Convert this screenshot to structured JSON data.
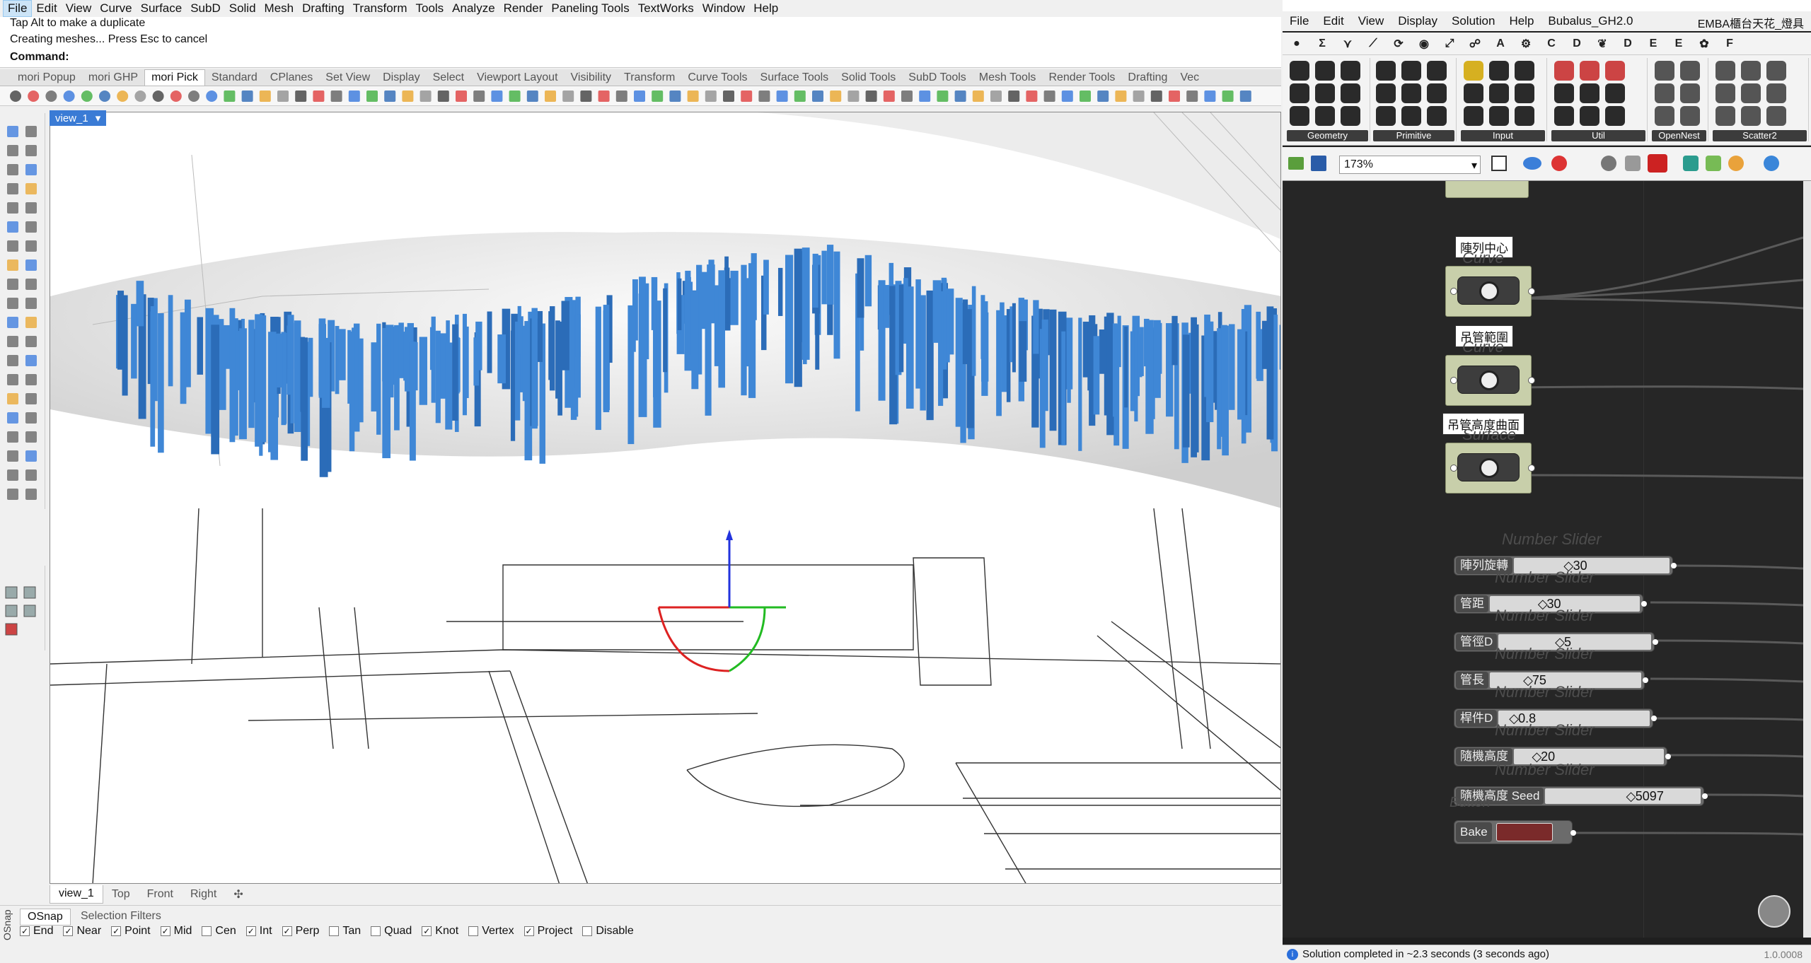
{
  "rhino": {
    "menu": [
      "File",
      "Edit",
      "View",
      "Curve",
      "Surface",
      "SubD",
      "Solid",
      "Mesh",
      "Drafting",
      "Transform",
      "Tools",
      "Analyze",
      "Render",
      "Paneling Tools",
      "TextWorks",
      "Window",
      "Help"
    ],
    "command_history": [
      "Tap Alt to make a duplicate",
      "Creating meshes... Press Esc to cancel"
    ],
    "command_prompt": "Command:",
    "toolbar_tabs": [
      "mori Popup",
      "mori GHP",
      "mori Pick",
      "Standard",
      "CPlanes",
      "Set View",
      "Display",
      "Select",
      "Viewport Layout",
      "Visibility",
      "Transform",
      "Curve Tools",
      "Surface Tools",
      "Solid Tools",
      "SubD Tools",
      "Mesh Tools",
      "Render Tools",
      "Drafting",
      "Vec"
    ],
    "active_tab": "mori Pick",
    "viewport_label": "view_1",
    "viewport_tabs": [
      "view_1",
      "Top",
      "Front",
      "Right"
    ],
    "osnap_tabs": [
      "OSnap",
      "Selection Filters"
    ],
    "osnap_side_label": "OSnap",
    "osnaps": [
      {
        "label": "End",
        "checked": true
      },
      {
        "label": "Near",
        "checked": true
      },
      {
        "label": "Point",
        "checked": true
      },
      {
        "label": "Mid",
        "checked": true
      },
      {
        "label": "Cen",
        "checked": false
      },
      {
        "label": "Int",
        "checked": true
      },
      {
        "label": "Perp",
        "checked": true
      },
      {
        "label": "Tan",
        "checked": false
      },
      {
        "label": "Quad",
        "checked": false
      },
      {
        "label": "Knot",
        "checked": true
      },
      {
        "label": "Vertex",
        "checked": false
      },
      {
        "label": "Project",
        "checked": true
      },
      {
        "label": "Disable",
        "checked": false
      }
    ]
  },
  "grasshopper": {
    "menu": [
      "File",
      "Edit",
      "View",
      "Display",
      "Solution",
      "Help",
      "Bubalus_GH2.0"
    ],
    "doc_title": "EMBA櫃台天花_燈具",
    "categories": [
      "●",
      "Σ",
      "⋎",
      "⟋",
      "⟳",
      "◉",
      "⤢",
      "☍",
      "A",
      "⚙",
      "C",
      "D",
      "❦",
      "D",
      "E",
      "E",
      "✿",
      "F"
    ],
    "panel_groups": [
      "Geometry",
      "Primitive",
      "Input",
      "Util",
      "OpenNest",
      "Scatter2"
    ],
    "zoom": "173%",
    "components": [
      {
        "tip": "陣列中心",
        "ghost": "Curve"
      },
      {
        "tip": "吊管範圍",
        "ghost": "Curve"
      },
      {
        "tip": "吊管高度曲面",
        "ghost": "Surface"
      }
    ],
    "slider_caption": "Number Slider",
    "sliders": [
      {
        "label": "陣列旋轉",
        "value": "30",
        "pos": 0.3
      },
      {
        "label": "管距",
        "value": "30",
        "pos": 0.3
      },
      {
        "label": "管徑D",
        "value": "5",
        "pos": 0.35
      },
      {
        "label": "管長",
        "value": "75",
        "pos": 0.2
      },
      {
        "label": "桿件D",
        "value": "0.8",
        "pos": 0.05
      },
      {
        "label": "隨機高度",
        "value": "20",
        "pos": 0.1
      },
      {
        "label": "隨機高度 Seed",
        "value": "5097",
        "pos": 0.5
      }
    ],
    "button_caption": "Button",
    "bake_label": "Bake",
    "status": "Solution completed in ~2.3 seconds (3 seconds ago)",
    "version": "1.0.0008"
  }
}
